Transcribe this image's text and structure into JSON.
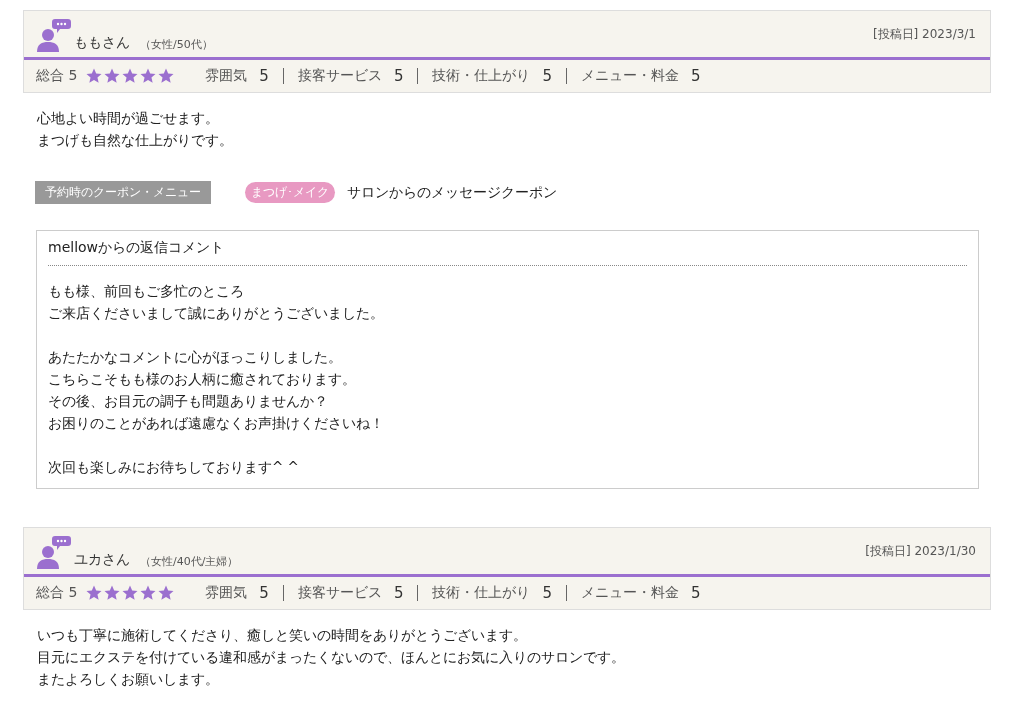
{
  "reviews": [
    {
      "name": "ももさん",
      "attributes": "（女性/50代）",
      "posted": "[投稿日] 2023/3/1",
      "overall": "総合 5",
      "stars": 5,
      "ratings": [
        {
          "label": "雰囲気",
          "score": "5"
        },
        {
          "label": "接客サービス",
          "score": "5"
        },
        {
          "label": "技術・仕上がり",
          "score": "5"
        },
        {
          "label": "メニュー・料金",
          "score": "5"
        }
      ],
      "comment": [
        "心地よい時間が過ごせます。",
        "まつげも自然な仕上がりです。"
      ],
      "coupon": {
        "heading": "予約時のクーポン・メニュー",
        "tag": "まつげ･メイク",
        "title": "サロンからのメッセージクーポン"
      },
      "reply": {
        "title": "mellowからの返信コメント",
        "paragraphs": [
          [
            "もも様、前回もご多忙のところ",
            "ご来店くださいまして誠にありがとうございました。"
          ],
          [
            "あたたかなコメントに心がほっこりしました。",
            "こちらこそもも様のお人柄に癒されております。",
            "その後、お目元の調子も問題ありませんか？",
            "お困りのことがあれば遠慮なくお声掛けくださいね！"
          ],
          [
            "次回も楽しみにお待ちしております^ ^"
          ]
        ]
      }
    },
    {
      "name": "ユカさん",
      "attributes": "（女性/40代/主婦）",
      "posted": "[投稿日] 2023/1/30",
      "overall": "総合 5",
      "stars": 5,
      "ratings": [
        {
          "label": "雰囲気",
          "score": "5"
        },
        {
          "label": "接客サービス",
          "score": "5"
        },
        {
          "label": "技術・仕上がり",
          "score": "5"
        },
        {
          "label": "メニュー・料金",
          "score": "5"
        }
      ],
      "comment": [
        "いつも丁寧に施術してくださり、癒しと笑いの時間をありがとうございます。",
        "目元にエクステを付けている違和感がまったくないので、ほんとにお気に入りのサロンです。",
        "またよろしくお願いします。"
      ]
    }
  ]
}
